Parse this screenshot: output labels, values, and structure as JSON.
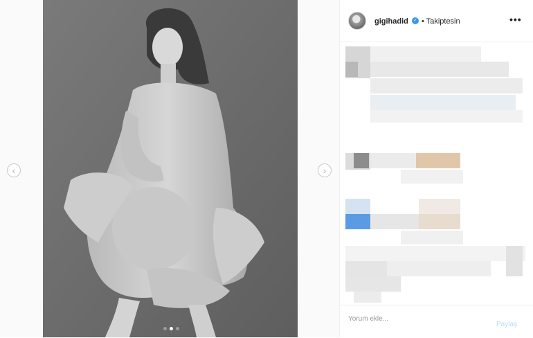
{
  "post": {
    "username": "gigihadid",
    "verified_icon": "verified-badge-icon",
    "follow_status": "• Takiptesin",
    "more_icon": "more-options-icon",
    "more_glyph": "•••"
  },
  "carousel": {
    "prev_icon": "chevron-left-icon",
    "next_icon": "chevron-right-icon",
    "prev_glyph": "‹",
    "next_glyph": "›",
    "slide_count": 3,
    "active_slide": 2
  },
  "footer": {
    "comment_placeholder": "Yorum ekle...",
    "post_label": "Paylaş"
  },
  "colors": {
    "verified": "#3897f0",
    "post_button_disabled": "#b3dbff",
    "photo_background": "#6f6f6f"
  }
}
